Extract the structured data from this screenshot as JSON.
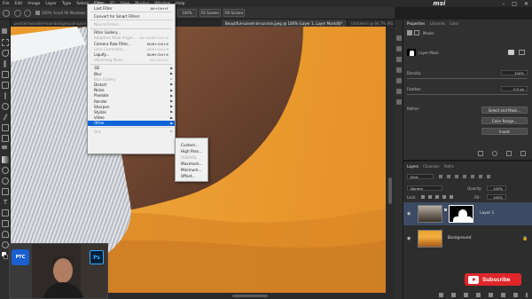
{
  "menubar": {
    "items": [
      "File",
      "Edit",
      "Image",
      "Layer",
      "Type",
      "Select",
      "Filter",
      "3D",
      "View",
      "Plugins",
      "Window",
      "Help"
    ],
    "brand": "msi"
  },
  "options": {
    "zoom": "100%",
    "scroll_all": "Scroll All Windows",
    "fit_label": "100%",
    "fit_screen": "Fit Screen",
    "fill_screen": "Fill Screen"
  },
  "tabs": [
    {
      "label": "portrait-bearded-man-background-sunrise",
      "active": false
    },
    {
      "label": "Beautiful-sunset-at-sunrise.jpeg @ 100% (Layer 1, Layer Mask/8)*",
      "active": true
    },
    {
      "label": "Untitled-3 @ 66.7% (RGB...",
      "active": false
    }
  ],
  "filter_menu": {
    "items": [
      {
        "label": "Last Filter",
        "shortcut": "Alt+Ctrl+F",
        "disabled": false,
        "arrow": false
      },
      {
        "sep": true
      },
      {
        "label": "Convert for Smart Filters",
        "shortcut": "",
        "disabled": false,
        "arrow": false
      },
      {
        "sep": true
      },
      {
        "label": "Neural Filters...",
        "shortcut": "",
        "disabled": true,
        "arrow": false
      },
      {
        "sep": true
      },
      {
        "label": "Filter Gallery...",
        "shortcut": "",
        "disabled": false,
        "arrow": false
      },
      {
        "label": "Adaptive Wide Angle...",
        "shortcut": "Alt+Shift+Ctrl+A",
        "disabled": true,
        "arrow": false
      },
      {
        "label": "Camera Raw Filter...",
        "shortcut": "Shift+Ctrl+A",
        "disabled": false,
        "arrow": false
      },
      {
        "label": "Lens Correction...",
        "shortcut": "Shift+Ctrl+R",
        "disabled": true,
        "arrow": false
      },
      {
        "label": "Liquify...",
        "shortcut": "Shift+Ctrl+X",
        "disabled": false,
        "arrow": false
      },
      {
        "label": "Vanishing Point...",
        "shortcut": "Alt+Ctrl+V",
        "disabled": true,
        "arrow": false
      },
      {
        "sep": true
      },
      {
        "label": "3D",
        "shortcut": "",
        "disabled": false,
        "arrow": true
      },
      {
        "label": "Blur",
        "shortcut": "",
        "disabled": false,
        "arrow": true
      },
      {
        "label": "Blur Gallery",
        "shortcut": "",
        "disabled": true,
        "arrow": true
      },
      {
        "label": "Distort",
        "shortcut": "",
        "disabled": false,
        "arrow": true
      },
      {
        "label": "Noise",
        "shortcut": "",
        "disabled": false,
        "arrow": true
      },
      {
        "label": "Pixelate",
        "shortcut": "",
        "disabled": false,
        "arrow": true
      },
      {
        "label": "Render",
        "shortcut": "",
        "disabled": false,
        "arrow": true
      },
      {
        "label": "Sharpen",
        "shortcut": "",
        "disabled": false,
        "arrow": true
      },
      {
        "label": "Stylize",
        "shortcut": "",
        "disabled": false,
        "arrow": true
      },
      {
        "label": "Video",
        "shortcut": "",
        "disabled": false,
        "arrow": true
      },
      {
        "label": "Other",
        "shortcut": "",
        "disabled": false,
        "arrow": true,
        "highlight": true
      },
      {
        "sep": true
      },
      {
        "label": "Dmi",
        "shortcut": "",
        "disabled": true,
        "arrow": true
      }
    ]
  },
  "other_submenu": {
    "items": [
      {
        "label": "Custom...",
        "disabled": false
      },
      {
        "label": "High Pass...",
        "disabled": false
      },
      {
        "label": "HSB/HSL",
        "disabled": true
      },
      {
        "label": "Maximum...",
        "disabled": false
      },
      {
        "label": "Minimum...",
        "disabled": false
      },
      {
        "label": "Offset...",
        "disabled": false
      }
    ]
  },
  "properties": {
    "tabs": [
      "Properties",
      "Libraries",
      "Color"
    ],
    "masks_label": "Masks",
    "layer_mask_label": "Layer Mask",
    "density_label": "Density:",
    "density_value": "100%",
    "feather_label": "Feather:",
    "feather_value": "0.0 px",
    "refine_label": "Refine:",
    "select_mask": "Select and Mask...",
    "color_range": "Color Range...",
    "invert": "Invert"
  },
  "layers": {
    "tabs": [
      "Layers",
      "Channels",
      "Paths"
    ],
    "kind": "Kind",
    "blend_mode": "Normal",
    "opacity_label": "Opacity:",
    "opacity_value": "100%",
    "lock_label": "Lock:",
    "fill_label": "Fill:",
    "fill_value": "100%",
    "rows": [
      {
        "name": "Layer 1",
        "selected": true
      },
      {
        "name": "Background",
        "selected": false
      }
    ]
  },
  "webcam": {
    "badge_left": "PTC",
    "badge_right": "Ps"
  },
  "subscribe": {
    "label": "Subscribe"
  },
  "colors": {
    "accent": "#0a64d8",
    "orange_bg": "#eda035",
    "subscribe_red": "#e0262a"
  }
}
